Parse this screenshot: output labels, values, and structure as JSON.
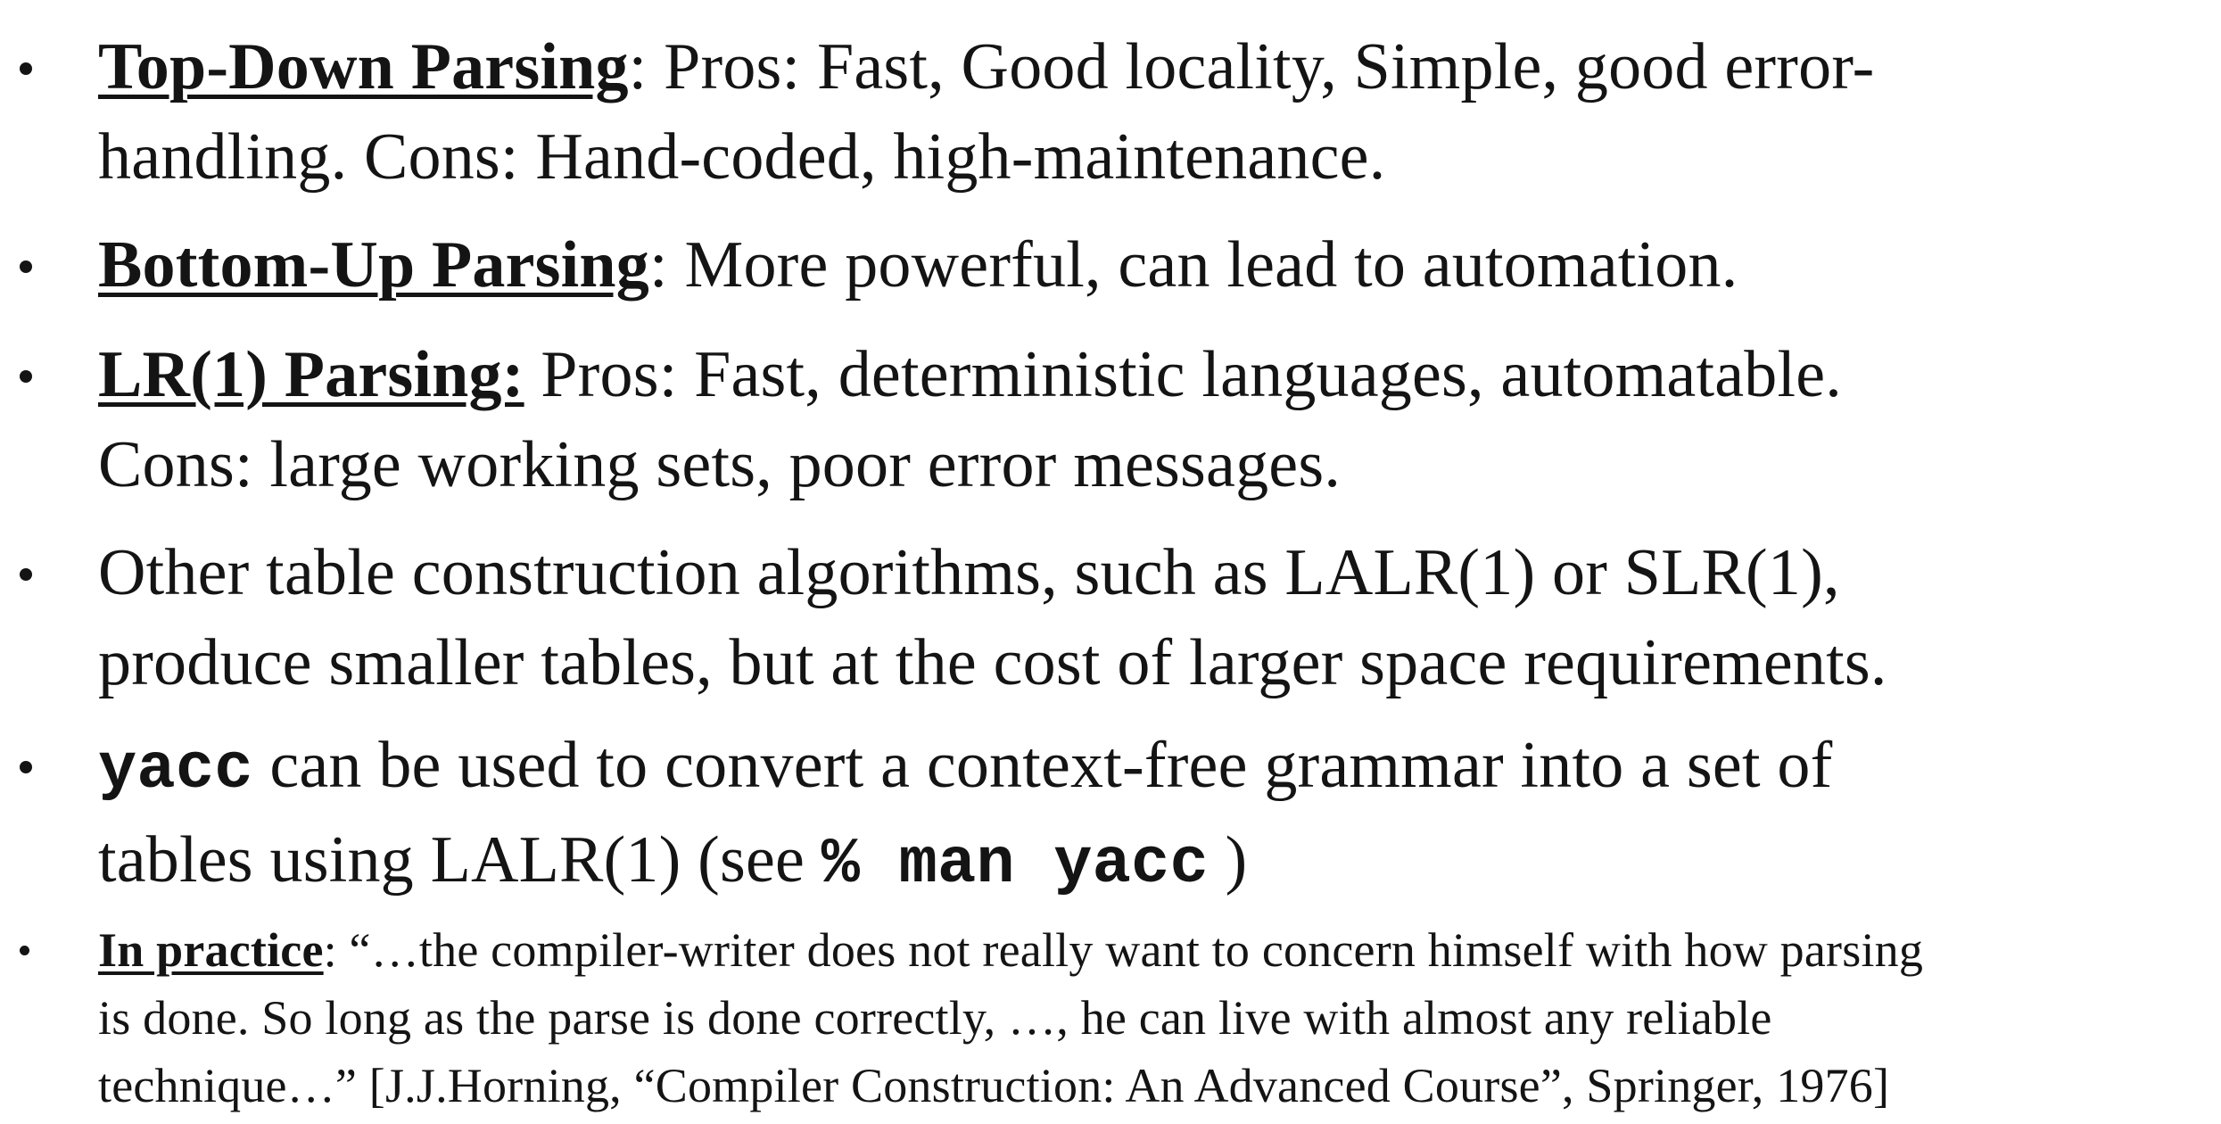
{
  "bullets": [
    {
      "term": "Top-Down Parsing",
      "sep": ":",
      "line1": " Pros: Fast, Good locality, Simple, good error-",
      "line2": "handling. Cons: Hand-coded, high-maintenance."
    },
    {
      "term": "Bottom-Up Parsing",
      "sep": ":",
      "line1": " More powerful, can lead to automation."
    },
    {
      "term": "LR(1) Parsing:",
      "line1": " Pros: Fast, deterministic languages, automatable.",
      "line2": "Cons: large working sets, poor error messages."
    },
    {
      "line1": "Other table construction algorithms, such as LALR(1) or SLR(1),",
      "line2": "produce smaller tables, but at the cost of larger space requirements."
    },
    {
      "code": "yacc",
      "line1": " can be used to convert a context-free grammar into a set of",
      "line2_pre": "tables using LALR(1) (see ",
      "line2_code": "% man yacc",
      "line2_post": " )"
    },
    {
      "term": "In practice",
      "sep": ":",
      "line1": " “…the compiler-writer does not really want to concern himself with how parsing",
      "line2": "is done. So long as the parse is done correctly, …, he can live with almost any reliable",
      "line3": "technique…” [J.J.Horning, “Compiler Construction: An Advanced Course”, Springer, 1976]"
    }
  ]
}
